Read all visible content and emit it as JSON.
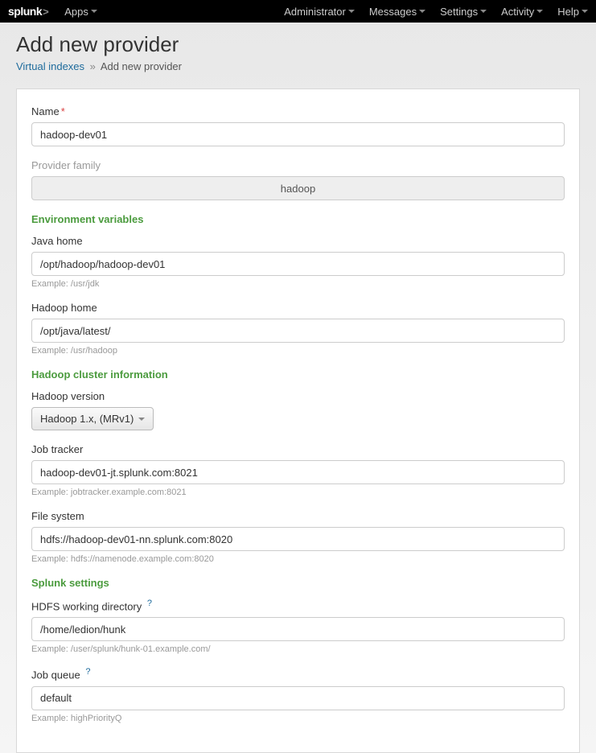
{
  "topbar": {
    "logo": "splunk",
    "apps_label": "Apps",
    "nav": [
      "Administrator",
      "Messages",
      "Settings",
      "Activity",
      "Help"
    ]
  },
  "header": {
    "title": "Add new provider",
    "breadcrumb_link": "Virtual indexes",
    "breadcrumb_current": "Add new provider"
  },
  "fields": {
    "name": {
      "label": "Name",
      "value": "hadoop-dev01"
    },
    "provider_family": {
      "label": "Provider family",
      "value": "hadoop"
    }
  },
  "sections": {
    "env": {
      "heading": "Environment variables",
      "java_home": {
        "label": "Java home",
        "value": "/opt/hadoop/hadoop-dev01",
        "hint": "Example: /usr/jdk"
      },
      "hadoop_home": {
        "label": "Hadoop home",
        "value": "/opt/java/latest/",
        "hint": "Example: /usr/hadoop"
      }
    },
    "cluster": {
      "heading": "Hadoop cluster information",
      "hadoop_version": {
        "label": "Hadoop version",
        "selected": "Hadoop 1.x, (MRv1)"
      },
      "job_tracker": {
        "label": "Job tracker",
        "value": "hadoop-dev01-jt.splunk.com:8021",
        "hint": "Example: jobtracker.example.com:8021"
      },
      "file_system": {
        "label": "File system",
        "value": "hdfs://hadoop-dev01-nn.splunk.com:8020",
        "hint": "Example: hdfs://namenode.example.com:8020"
      }
    },
    "splunk": {
      "heading": "Splunk settings",
      "hdfs_dir": {
        "label": "HDFS working directory",
        "value": "/home/ledion/hunk",
        "hint": "Example: /user/splunk/hunk-01.example.com/"
      },
      "job_queue": {
        "label": "Job queue",
        "value": "default",
        "hint": "Example: highPriorityQ"
      }
    }
  }
}
